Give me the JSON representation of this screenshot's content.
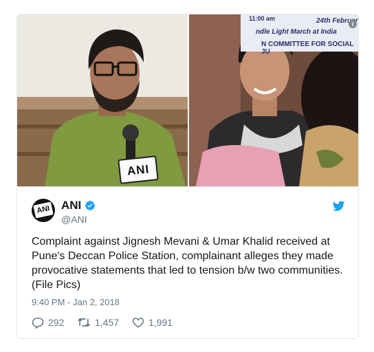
{
  "media": {
    "left_mic_label": "ANI",
    "banner": {
      "line1": "11:00 am",
      "line1_right": "24th Februar",
      "line2": "ndle Light March at India",
      "line3": "N COMMITTEE FOR SOCIAL JU"
    },
    "info_label": "i"
  },
  "author": {
    "avatar_text": "ANI",
    "name": "ANI",
    "handle": "@ANI"
  },
  "tweet": {
    "text": "Complaint against Jignesh Mevani & Umar Khalid received at Pune's Deccan Police Station, complainant alleges they made provocative statements that led to tension b/w two communities. (File Pics)",
    "timestamp": "9:40 PM - Jan 2, 2018"
  },
  "actions": {
    "replies": "292",
    "retweets": "1,457",
    "likes": "1,991"
  },
  "colors": {
    "verified": "#1da1f2",
    "twitter_blue": "#1da1f2",
    "muted": "#657786"
  }
}
